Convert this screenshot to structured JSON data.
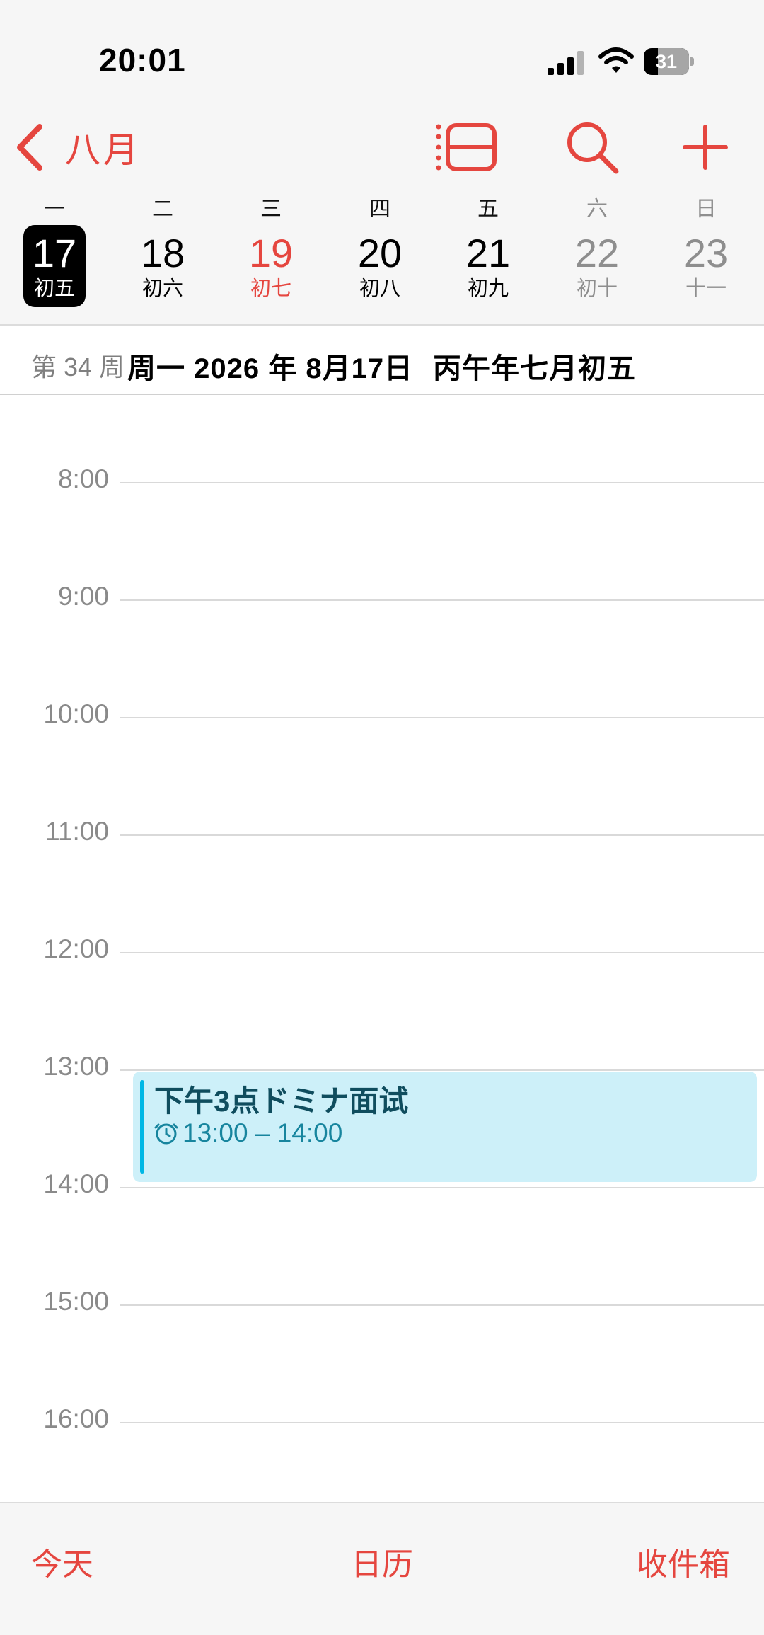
{
  "status_bar": {
    "time": "20:01",
    "battery": "31",
    "battery_level": 0.31
  },
  "nav": {
    "back_label": "八月",
    "icons": [
      "chevron-left-icon",
      "list-view-icon",
      "search-icon",
      "add-icon"
    ]
  },
  "weekdays": [
    "一",
    "二",
    "三",
    "四",
    "五",
    "六",
    "日"
  ],
  "days": [
    {
      "num": "17",
      "lunar": "初五",
      "state": "today"
    },
    {
      "num": "18",
      "lunar": "初六",
      "state": "normal"
    },
    {
      "num": "19",
      "lunar": "初七",
      "state": "red"
    },
    {
      "num": "20",
      "lunar": "初八",
      "state": "normal"
    },
    {
      "num": "21",
      "lunar": "初九",
      "state": "normal"
    },
    {
      "num": "22",
      "lunar": "初十",
      "state": "weekend"
    },
    {
      "num": "23",
      "lunar": "十一",
      "state": "weekend"
    }
  ],
  "info": {
    "week_number": "第 34 周",
    "full_date": "周一 2026 年 8月17日",
    "lunar_date": "丙午年七月初五"
  },
  "hours": [
    "8:00",
    "9:00",
    "10:00",
    "11:00",
    "12:00",
    "13:00",
    "14:00",
    "15:00",
    "16:00"
  ],
  "event": {
    "title": "下午3点ドミナ面试",
    "time": "13:00 – 14:00",
    "color": "#cdf0f9",
    "accent": "#00b7e5"
  },
  "tabs": {
    "today": "今天",
    "calendars": "日历",
    "inbox": "收件箱"
  },
  "colors": {
    "accent": "#e5463f",
    "background": "#f6f6f6",
    "muted": "#8e8e8e"
  }
}
